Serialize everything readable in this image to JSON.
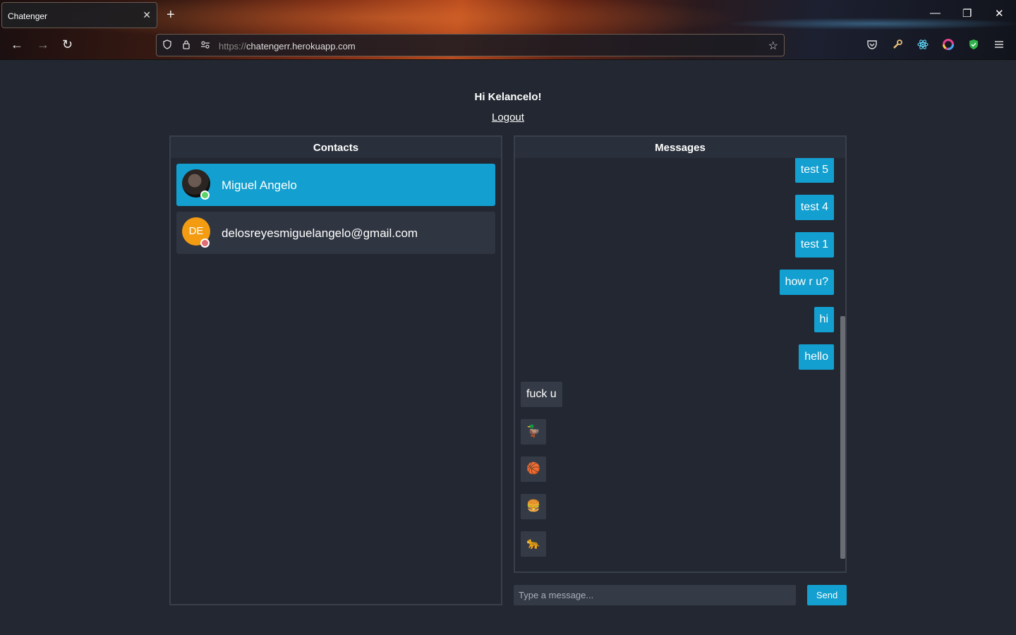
{
  "browser": {
    "tab_title": "Chatenger",
    "tab_close": "✕",
    "new_tab": "+",
    "url_scheme": "https://",
    "url_host": "chatengerr.herokuapp.com",
    "minimize": "—",
    "restore": "❐",
    "close": "✕",
    "back": "←",
    "forward": "→",
    "reload": "↻",
    "bookmark": "☆"
  },
  "app": {
    "greeting": "Hi Kelancelo!",
    "logout_label": "Logout"
  },
  "contacts": {
    "title": "Contacts",
    "items": [
      {
        "name": "Miguel Angelo",
        "status": "online",
        "active": true,
        "avatar": "photo"
      },
      {
        "name": "delosreyesmiguelangelo@gmail.com",
        "status": "offline",
        "active": false,
        "initials": "DE"
      }
    ]
  },
  "messages": {
    "title": "Messages",
    "items": [
      {
        "text": "test 5",
        "from": "me"
      },
      {
        "text": "test 4",
        "from": "me"
      },
      {
        "text": "test 1",
        "from": "me"
      },
      {
        "text": "how r u?",
        "from": "me"
      },
      {
        "text": "hi",
        "from": "me"
      },
      {
        "text": "hello",
        "from": "me"
      },
      {
        "text": "fuck u",
        "from": "them"
      },
      {
        "text": "🦆",
        "from": "them"
      },
      {
        "text": "🏀",
        "from": "them"
      },
      {
        "text": "🍔",
        "from": "them"
      },
      {
        "text": "🐆",
        "from": "them"
      }
    ]
  },
  "composer": {
    "placeholder": "Type a message...",
    "send_label": "Send"
  },
  "colors": {
    "accent": "#139fcf",
    "background": "#222731",
    "online": "#5ad36a",
    "offline": "#e06c75",
    "initials_avatar": "#f39c12"
  }
}
